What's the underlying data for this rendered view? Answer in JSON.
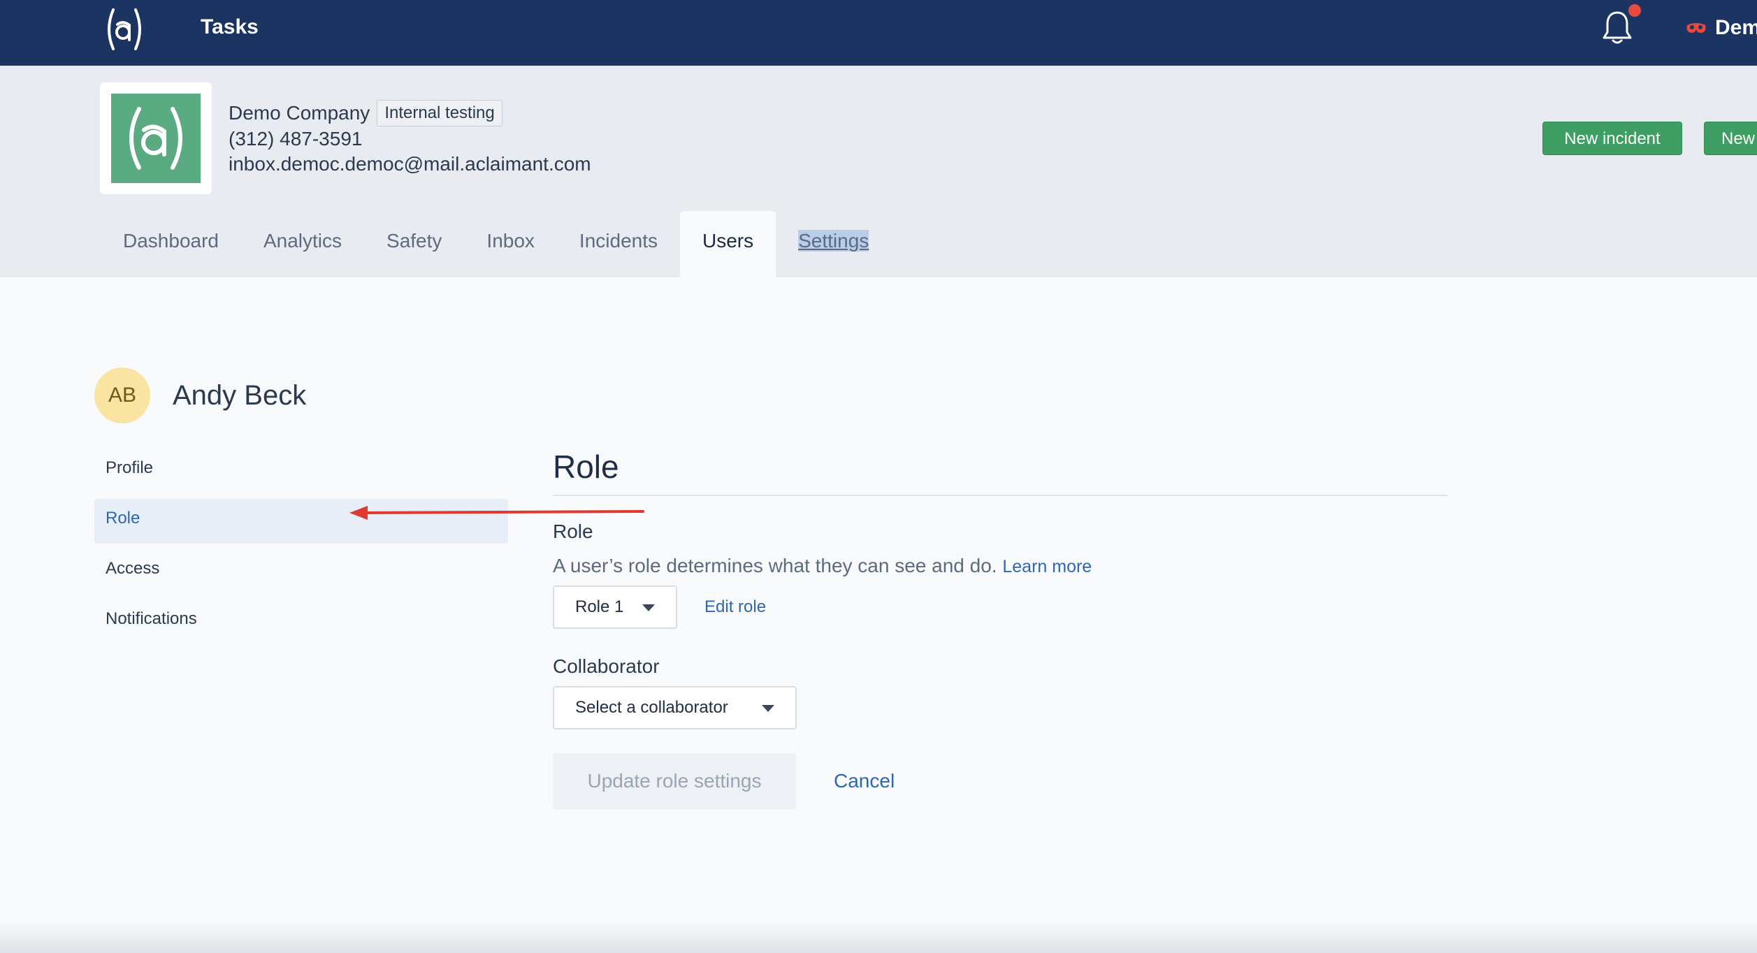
{
  "topbar": {
    "title": "Tasks",
    "user_label": "Dem",
    "colors": {
      "background": "#1b3461",
      "notification_dot": "#e94a3f"
    },
    "icons": [
      "aclaimant-logo-icon",
      "bell-icon",
      "user-mask-icon"
    ]
  },
  "company": {
    "name": "Demo Company",
    "badge": "Internal testing",
    "phone": "(312) 487-3591",
    "email": "inbox.democ.democ@mail.aclaimant.com",
    "logo_color": "#5aaa82"
  },
  "actions": {
    "new_incident": "New incident",
    "new_other": "New",
    "color": "#3f9e63"
  },
  "tabs": [
    {
      "label": "Dashboard"
    },
    {
      "label": "Analytics"
    },
    {
      "label": "Safety"
    },
    {
      "label": "Inbox"
    },
    {
      "label": "Incidents"
    },
    {
      "label": "Users",
      "active": true
    },
    {
      "label": "Settings",
      "text_selected": true
    }
  ],
  "user": {
    "initials": "AB",
    "name": "Andy Beck"
  },
  "side_menu": [
    {
      "label": "Profile"
    },
    {
      "label": "Role",
      "active": true
    },
    {
      "label": "Access"
    },
    {
      "label": "Notifications"
    }
  ],
  "content": {
    "title": "Role",
    "role_label": "Role",
    "role_help": "A user’s role determines what they can see and do.",
    "learn_more": "Learn more",
    "role_value": "Role 1",
    "edit_role": "Edit role",
    "collaborator_label": "Collaborator",
    "collaborator_value": "Select a collaborator",
    "update_button": "Update role settings",
    "cancel_button": "Cancel",
    "link_color": "#2c67b3"
  },
  "annotation": {
    "color": "#e0392f",
    "icon": "arrow-left-icon"
  }
}
